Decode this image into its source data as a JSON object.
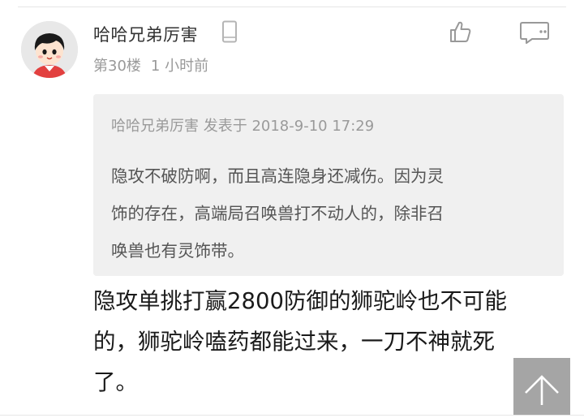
{
  "post": {
    "username": "哈哈兄弟厉害",
    "floor": "第30楼",
    "time": "1 小时前"
  },
  "quote": {
    "header": "哈哈兄弟厉害 发表于 2018-9-10 17:29",
    "lines": [
      "隐攻不破防啊，而且高连隐身还减伤。因为灵",
      "饰的存在，高端局召唤兽打不动人的，除非召",
      "唤兽也有灵饰带。"
    ]
  },
  "content": {
    "lines": [
      "隐攻单挑打赢2800防御的狮驼岭也不可能",
      "的，狮驼岭嗑药都能过来，一刀不神就死",
      "了。"
    ]
  },
  "icons": {
    "avatar": "cartoon-avatar",
    "device": "phone-icon",
    "like": "thumbs-up-icon",
    "comment": "comment-icon",
    "back_to_top": "arrow-up-icon"
  },
  "colors": {
    "quote_background": "#f0f0f0",
    "meta_text": "#999999",
    "main_text": "#1a1a1a",
    "back_to_top_bg": "#9c9c9c"
  }
}
